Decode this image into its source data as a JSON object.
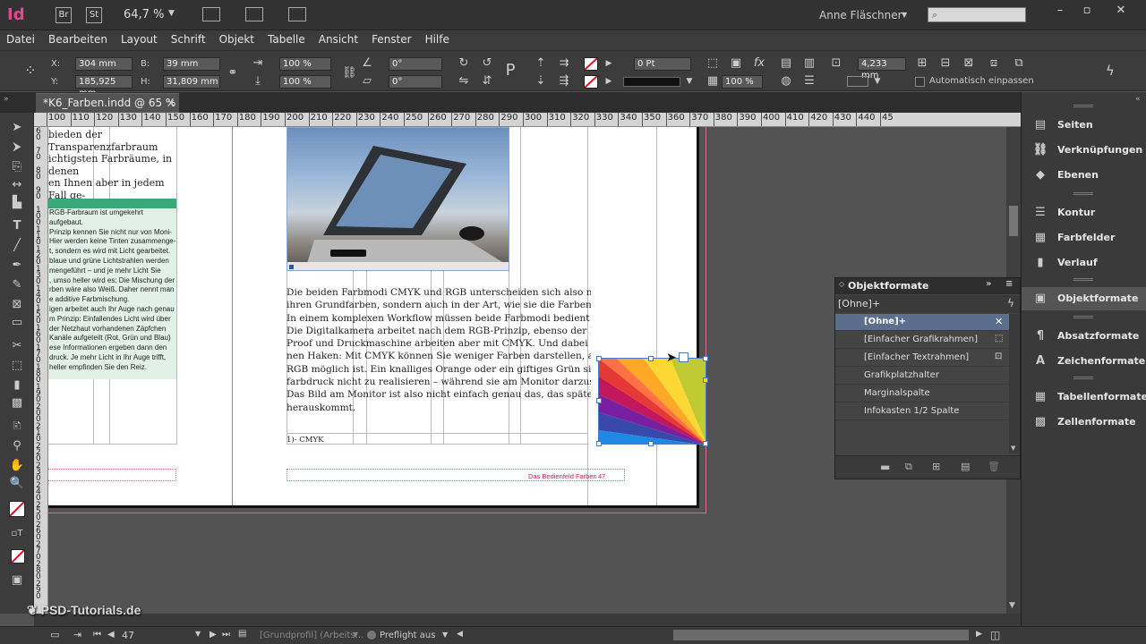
{
  "app": {
    "logo": "Id",
    "bridge": "Br",
    "stock": "St",
    "zoom": "64,7 %",
    "user": "Anne Fläschner",
    "search_placeholder": ""
  },
  "menu": [
    "Datei",
    "Bearbeiten",
    "Layout",
    "Schrift",
    "Objekt",
    "Tabelle",
    "Ansicht",
    "Fenster",
    "Hilfe"
  ],
  "control": {
    "x_label": "X:",
    "x_value": "304 mm",
    "y_label": "Y:",
    "y_value": "185,925 mm",
    "b_label": "B:",
    "b_value": "39 mm",
    "h_label": "H:",
    "h_value": "31,809 mm",
    "scale_x": "100 %",
    "scale_y": "100 %",
    "rotate": "0°",
    "shear": "0°",
    "stroke_weight": "0 Pt",
    "opacity": "100 %",
    "offset": "4,233 mm",
    "autofit_label": "Automatisch einpassen"
  },
  "document_tab": {
    "title": "*K6_Farben.indd @ 65 %",
    "close": "×"
  },
  "ruler": {
    "h_ticks": [
      "100",
      "110",
      "120",
      "130",
      "140",
      "150",
      "160",
      "170",
      "180",
      "190",
      "200",
      "210",
      "220",
      "230",
      "240",
      "250",
      "260",
      "270",
      "280",
      "290",
      "300",
      "310",
      "320",
      "330",
      "340",
      "350",
      "360",
      "370",
      "380",
      "390",
      "400",
      "410",
      "420",
      "430",
      "440",
      "45"
    ],
    "v_ticks": [
      "6 0",
      "7 0",
      "8 0",
      "9 0",
      "1 0 0",
      "1 1 0",
      "1 2 0",
      "1 3 0",
      "1 4 0",
      "1 5 0",
      "1 6 0",
      "1 7 0",
      "1 8 0",
      "1 9 0",
      "2 0 0",
      "2 1 0",
      "2 2 0",
      "2 3 0",
      "2 4 0",
      "2 5 0",
      "2 6 0",
      "2 7 0",
      "2 8 0",
      "2 9 0"
    ]
  },
  "page_left": {
    "top_text": [
      "bieden der Transparenzfarbraum",
      "ichtigsten Farbräume, in denen",
      "en Ihnen aber in jedem Fall ge-"
    ],
    "box_text": [
      "RGB-Farbraum ist umgekehrt aufgebaut.",
      "Prinzip kennen Sie nicht nur von Moni-",
      "Hier werden keine Tinten zusammenge-",
      "t, sondern es wird mit Licht gearbeitet.",
      "blaue und grüne Lichtstrahlen werden",
      "mengeführt – und je mehr Licht Sie",
      ", umso heller wird es: Die Mischung der",
      "rben wäre also Weiß. Daher nennt man",
      "e additive Farbmischung.",
      "igen arbeitet auch Ihr Auge nach genau",
      "m Prinzip: Einfallendes Licht wird über",
      "der Netzhaut vorhandenen Zäpfchen",
      "Kanäle aufgeteilt (Rot, Grün und Blau)",
      "ese Informationen ergeben dann den",
      "druck. Je mehr Licht in Ihr Auge trifft,",
      "heller empfinden Sie den Reiz."
    ]
  },
  "page_right": {
    "body_text": [
      "Die beiden Farbmodi CMYK und RGB unterscheiden sich also nicht nur in",
      "ihren Grundfarben, sondern auch in der Art, wie sie die Farben erzeugen.",
      "In einem komplexen Workflow müssen beide Farbmodi bedient werden:",
      "Die Digitalkamera arbeitet nach dem RGB-Prinzip, ebenso der Monitor.",
      "Proof und Druckmaschine arbeiten aber mit CMYK. Und dabei gibt es ei-",
      "nen Haken: Mit CMYK können Sie weniger Farben darstellen, als es mit",
      "RGB möglich ist. Ein knalliges Orange oder ein giftiges Grün sind im Vier-",
      "farbdruck nicht zu realisieren – während sie am Monitor darzustellen sind.",
      "Das Bild am Monitor ist also nicht einfach genau das, das später im Druck",
      "herauskommt."
    ],
    "footnote": "1)- CMYK",
    "footer_text": "Das Bedienfeld Farben",
    "page_number": "47"
  },
  "dock": {
    "items": [
      {
        "icon": "pages-icon",
        "label": "Seiten"
      },
      {
        "icon": "links-icon",
        "label": "Verknüpfungen"
      },
      {
        "icon": "layers-icon",
        "label": "Ebenen"
      },
      {
        "icon": "stroke-icon",
        "label": "Kontur"
      },
      {
        "icon": "swatches-icon",
        "label": "Farbfelder"
      },
      {
        "icon": "gradient-icon",
        "label": "Verlauf"
      },
      {
        "icon": "object-styles-icon",
        "label": "Objektformate"
      },
      {
        "icon": "paragraph-styles-icon",
        "label": "Absatzformate"
      },
      {
        "icon": "character-styles-icon",
        "label": "Zeichenformate"
      },
      {
        "icon": "table-styles-icon",
        "label": "Tabellenformate"
      },
      {
        "icon": "cell-styles-icon",
        "label": "Zellenformate"
      }
    ]
  },
  "object_panel": {
    "title": "Objektformate",
    "current": "[Ohne]+",
    "rows": [
      {
        "label": "[Ohne]+",
        "selected": true
      },
      {
        "label": "[Einfacher Grafikrahmen]",
        "selected": false
      },
      {
        "label": "[Einfacher Textrahmen]",
        "selected": false
      },
      {
        "label": "Grafikplatzhalter",
        "selected": false
      },
      {
        "label": "Marginalspalte",
        "selected": false
      },
      {
        "label": "Infokasten 1/2 Spalte",
        "selected": false
      }
    ]
  },
  "status": {
    "page": "47",
    "profile": "[Grundprofil] (Arbeits...",
    "preflight": "Preflight aus",
    "watermark": "PSD-Tutorials.de"
  },
  "colors": {
    "accent": "#e0498e",
    "selection": "#5c6e8e",
    "guide_green": "#3aa877",
    "margin_pink": "#d2728f"
  }
}
